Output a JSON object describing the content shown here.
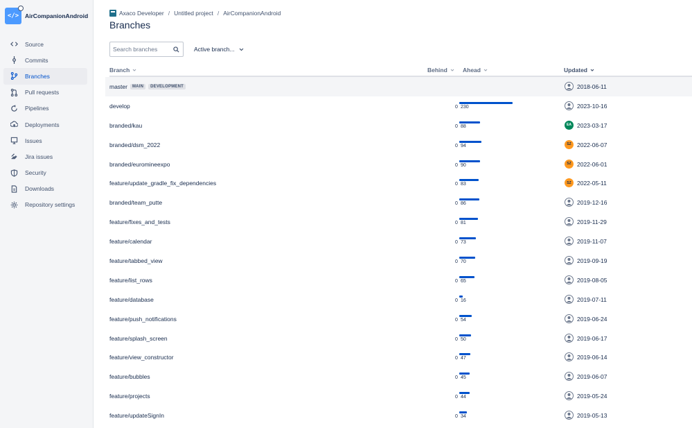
{
  "repo": {
    "name": "AirCompanionAndroid",
    "icon": "code-icon"
  },
  "nav": [
    {
      "label": "Source",
      "icon": "source-icon"
    },
    {
      "label": "Commits",
      "icon": "commits-icon"
    },
    {
      "label": "Branches",
      "icon": "branches-icon",
      "active": true
    },
    {
      "label": "Pull requests",
      "icon": "pull-requests-icon"
    },
    {
      "label": "Pipelines",
      "icon": "pipelines-icon"
    },
    {
      "label": "Deployments",
      "icon": "deployments-icon"
    },
    {
      "label": "Issues",
      "icon": "issues-icon"
    },
    {
      "label": "Jira issues",
      "icon": "jira-icon"
    },
    {
      "label": "Security",
      "icon": "shield-icon"
    },
    {
      "label": "Downloads",
      "icon": "downloads-icon"
    },
    {
      "label": "Repository settings",
      "icon": "gear-icon"
    }
  ],
  "breadcrumb": {
    "workspace": "Axaco Developer",
    "project": "Untitled project",
    "repo": "AirCompanionAndroid"
  },
  "page": {
    "title": "Branches"
  },
  "search": {
    "placeholder": "Search branches"
  },
  "filter": {
    "label": "Active branch..."
  },
  "table": {
    "headers": {
      "branch": "Branch",
      "behind": "Behind",
      "ahead": "Ahead",
      "updated": "Updated"
    },
    "rows": [
      {
        "name": "master",
        "badges": [
          "MAIN",
          "DEVELOPMENT"
        ],
        "behind": "",
        "ahead": "",
        "updated": "2018-06-11",
        "avatar": "default"
      },
      {
        "name": "develop",
        "behind": "0",
        "ahead": "230",
        "updated": "2023-10-16",
        "avatar": "default"
      },
      {
        "name": "branded/kau",
        "behind": "0",
        "ahead": "88",
        "updated": "2023-03-17",
        "avatar": "EA"
      },
      {
        "name": "branded/dsm_2022",
        "behind": "0",
        "ahead": "94",
        "updated": "2022-06-07",
        "avatar": "SZ"
      },
      {
        "name": "branded/euromineexpo",
        "behind": "0",
        "ahead": "90",
        "updated": "2022-06-01",
        "avatar": "SZ"
      },
      {
        "name": "feature/update_gradle_fix_dependencies",
        "behind": "0",
        "ahead": "83",
        "updated": "2022-05-11",
        "avatar": "SZ"
      },
      {
        "name": "branded/team_putte",
        "behind": "0",
        "ahead": "86",
        "updated": "2019-12-16",
        "avatar": "default"
      },
      {
        "name": "feature/fixes_and_tests",
        "behind": "0",
        "ahead": "81",
        "updated": "2019-11-29",
        "avatar": "default"
      },
      {
        "name": "feature/calendar",
        "behind": "0",
        "ahead": "73",
        "updated": "2019-11-07",
        "avatar": "default"
      },
      {
        "name": "feature/tabbed_view",
        "behind": "0",
        "ahead": "70",
        "updated": "2019-09-19",
        "avatar": "default"
      },
      {
        "name": "feature/list_rows",
        "behind": "0",
        "ahead": "65",
        "updated": "2019-08-05",
        "avatar": "default"
      },
      {
        "name": "feature/database",
        "behind": "0",
        "ahead": "16",
        "updated": "2019-07-11",
        "avatar": "default"
      },
      {
        "name": "feature/push_notifications",
        "behind": "0",
        "ahead": "54",
        "updated": "2019-06-24",
        "avatar": "default"
      },
      {
        "name": "feature/splash_screen",
        "behind": "0",
        "ahead": "50",
        "updated": "2019-06-17",
        "avatar": "default"
      },
      {
        "name": "feature/view_constructor",
        "behind": "0",
        "ahead": "47",
        "updated": "2019-06-14",
        "avatar": "default"
      },
      {
        "name": "feature/bubbles",
        "behind": "0",
        "ahead": "45",
        "updated": "2019-06-07",
        "avatar": "default"
      },
      {
        "name": "feature/projects",
        "behind": "0",
        "ahead": "44",
        "updated": "2019-05-24",
        "avatar": "default"
      },
      {
        "name": "feature/updateSignIn",
        "behind": "0",
        "ahead": "34",
        "updated": "2019-05-13",
        "avatar": "default"
      }
    ]
  },
  "colors": {
    "accent": "#0052cc",
    "ea_avatar": "#00875a",
    "sz_avatar": "#ff991f"
  }
}
